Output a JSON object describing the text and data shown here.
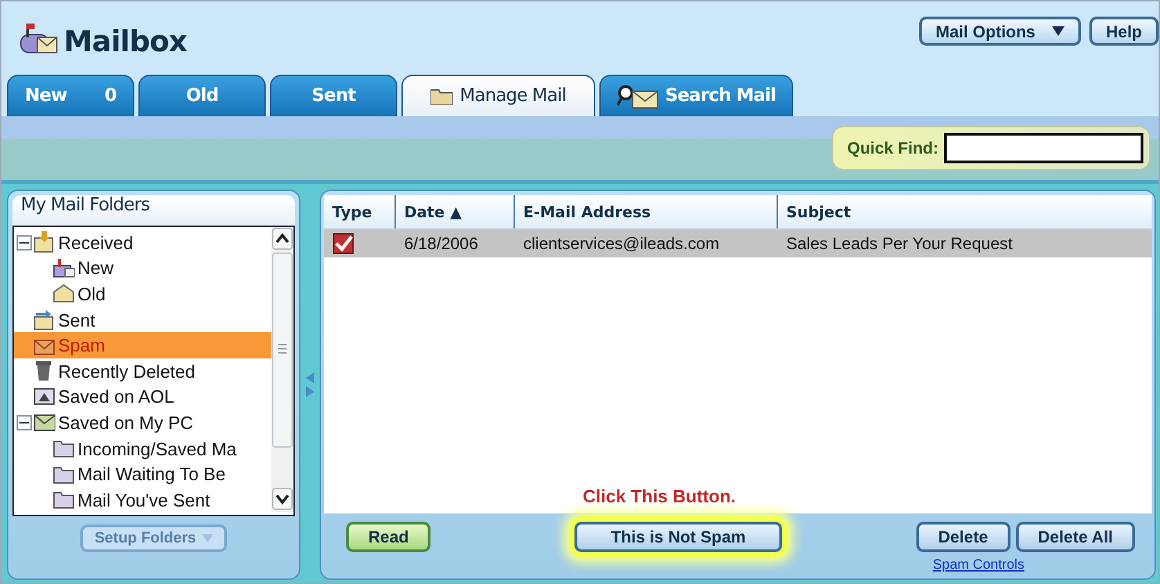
{
  "window": {
    "title": "Mailbox"
  },
  "header_buttons": [
    {
      "label": "Mail Options",
      "dropdown": true
    },
    {
      "label": "Help",
      "dropdown": false
    }
  ],
  "tabs": [
    {
      "label": "New",
      "count": "0",
      "kind": "plain",
      "selected": false
    },
    {
      "label": "Old",
      "kind": "plain",
      "selected": false
    },
    {
      "label": "Sent",
      "kind": "plain",
      "selected": false
    },
    {
      "label": "Manage Mail",
      "kind": "folder",
      "selected": true
    },
    {
      "label": "Search Mail",
      "kind": "search",
      "selected": false
    }
  ],
  "quick_find": {
    "label": "Quick Find:"
  },
  "folders": {
    "title": "My Mail Folders",
    "items": [
      {
        "label": "Received",
        "kind": "received",
        "expanded": true,
        "selected": false,
        "children": [
          {
            "label": "New",
            "kind": "new",
            "selected": false
          },
          {
            "label": "Old",
            "kind": "old",
            "selected": false
          }
        ]
      },
      {
        "label": "Sent",
        "kind": "sent",
        "selected": false
      },
      {
        "label": "Spam",
        "kind": "spam",
        "selected": true
      },
      {
        "label": "Recently Deleted",
        "kind": "trash",
        "selected": false
      },
      {
        "label": "Saved on AOL",
        "kind": "aol",
        "selected": false
      },
      {
        "label": "Saved on My PC",
        "kind": "pc",
        "expanded": true,
        "selected": false,
        "children": [
          {
            "label": "Incoming/Saved Ma",
            "kind": "folder",
            "selected": false
          },
          {
            "label": "Mail Waiting To Be",
            "kind": "folder",
            "selected": false
          },
          {
            "label": "Mail You've Sent",
            "kind": "folder",
            "selected": false
          }
        ]
      }
    ],
    "button": {
      "label": "Setup Folders",
      "disabled": true
    }
  },
  "table": {
    "columns": [
      "Type",
      "Date ▲",
      "E-Mail Address",
      "Subject"
    ],
    "rows": [
      {
        "date": "6/18/2006",
        "address": "clientservices@ileads.com",
        "subject": "Sales Leads Per Your Request",
        "selected": true
      }
    ]
  },
  "callout": "Click This Button.",
  "actions": [
    {
      "label": "Read",
      "kind": "green",
      "highlighted": false
    },
    {
      "label": "This is Not Spam",
      "kind": "blue",
      "highlighted": true
    },
    {
      "label": "Delete",
      "kind": "blue",
      "highlighted": false
    },
    {
      "label": "Delete All",
      "kind": "blue",
      "highlighted": false
    }
  ],
  "link": "Spam Controls"
}
